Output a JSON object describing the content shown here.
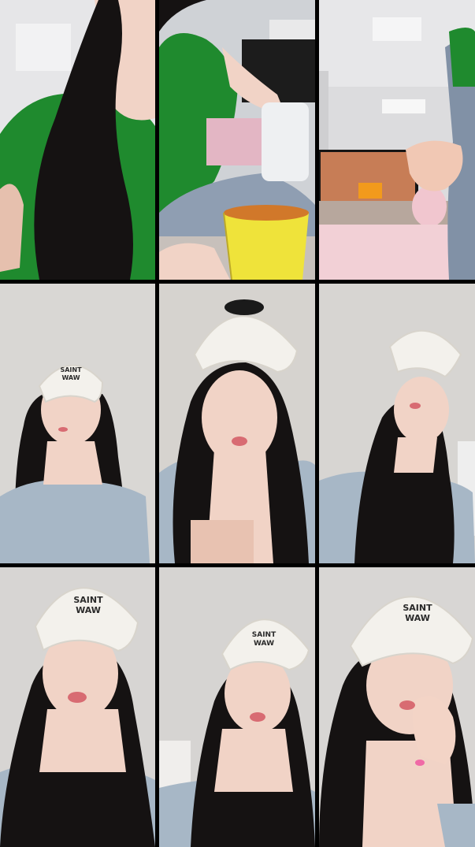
{
  "layout": {
    "columns": 3,
    "rows": 3
  },
  "colors": {
    "divider": "#000000",
    "wall": "#d9d7d4",
    "green_top": "#1f8a2e",
    "blue_top": "#a7b7c6",
    "hair": "#151212",
    "skin": "#f1d3c6",
    "cap": "#f3f1ec",
    "cup": "#efe33a"
  },
  "tiles": [
    {
      "id": "tile-1",
      "scene": "green-top-closeup"
    },
    {
      "id": "tile-2",
      "scene": "green-top-with-cup"
    },
    {
      "id": "tile-3",
      "scene": "room-with-tv"
    },
    {
      "id": "tile-4",
      "scene": "white-cap-blue-top"
    },
    {
      "id": "tile-5",
      "scene": "white-cap-closeup"
    },
    {
      "id": "tile-6",
      "scene": "white-cap-blue-top"
    },
    {
      "id": "tile-7",
      "scene": "white-cap-blue-top"
    },
    {
      "id": "tile-8",
      "scene": "white-cap-blue-top"
    },
    {
      "id": "tile-9",
      "scene": "white-cap-hand-on-face"
    }
  ],
  "cap_text": {
    "line1": "SAINT",
    "line2": "WAW"
  }
}
